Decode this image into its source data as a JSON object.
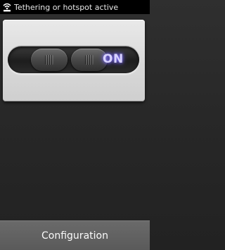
{
  "status_bar": {
    "icon": "wifi-hotspot-icon",
    "notification_text": "Tethering or hotspot active"
  },
  "toggle": {
    "state_label": "ON",
    "state": "on",
    "glow_color": "#8c7cff"
  },
  "footer": {
    "configuration_label": "Configuration"
  }
}
